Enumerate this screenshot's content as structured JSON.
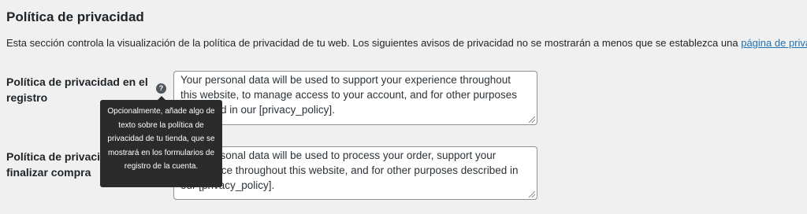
{
  "section": {
    "title": "Política de privacidad",
    "description_before": "Esta sección controla la visualización de la política de privacidad de tu web. Los siguientes avisos de privacidad no se mostrarán a menos que se establezca una ",
    "description_link": "página de privacidad",
    "description_after": "."
  },
  "fields": [
    {
      "label": "Política de privacidad en el registro",
      "help_icon": "question-circle-icon",
      "value": "Your personal data will be used to support your experience throughout this website, to manage access to your account, and for other purposes described in our [privacy_policy]."
    },
    {
      "label": "Política de privacidad al finalizar compra",
      "value": "Your personal data will be used to process your order, support your experience throughout this website, and for other purposes described in our [privacy_policy]."
    }
  ],
  "tooltip": {
    "text": "Opcionalmente, añade algo de texto sobre la política de privacidad de tu tienda, que se mostrará en los formularios de registro de la cuenta."
  }
}
